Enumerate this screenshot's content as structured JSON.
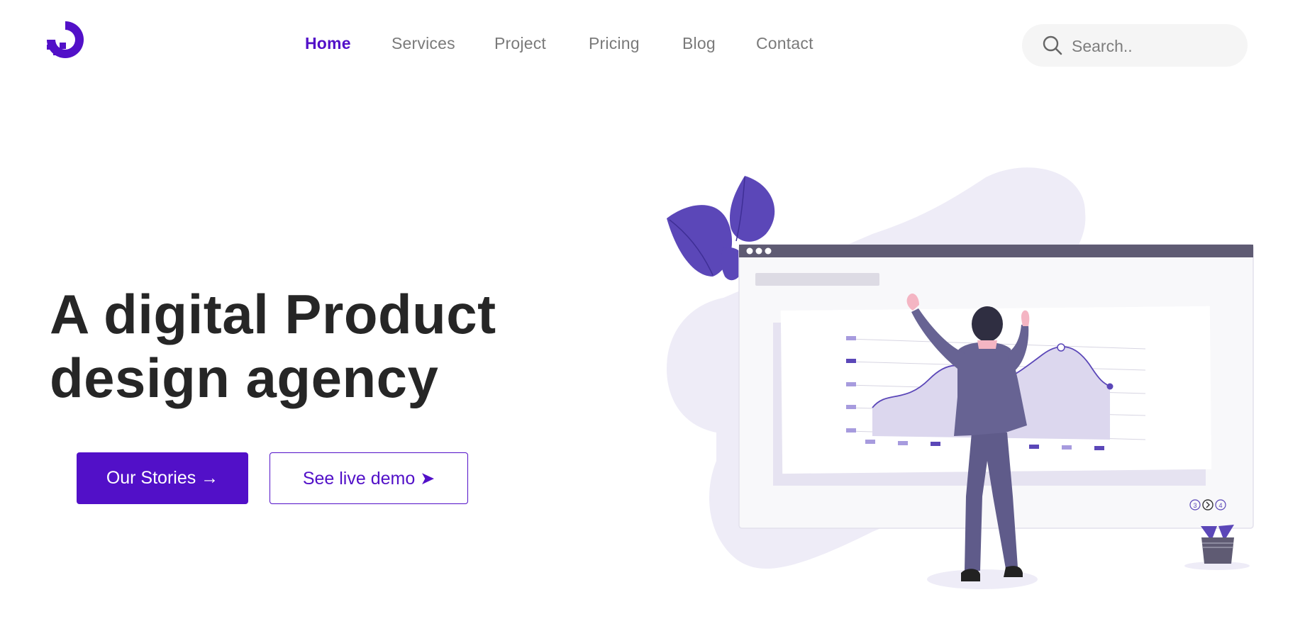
{
  "nav": {
    "items": [
      {
        "label": "Home",
        "active": true
      },
      {
        "label": "Services",
        "active": false
      },
      {
        "label": "Project",
        "active": false
      },
      {
        "label": "Pricing",
        "active": false
      },
      {
        "label": "Blog",
        "active": false
      },
      {
        "label": "Contact",
        "active": false
      }
    ]
  },
  "search": {
    "placeholder": "Search.."
  },
  "hero": {
    "headline_line1": "A digital Product",
    "headline_line2": "design agency",
    "primary_button": "Our Stories →",
    "secondary_button": "See live demo ➤"
  },
  "illustration": {
    "pager": {
      "prev": "3",
      "next": "4"
    }
  },
  "colors": {
    "brand": "#5210c8",
    "illustration_purple": "#5b47b8",
    "illustration_blob": "#eeecf7",
    "window_bar": "#5f5b73",
    "headline_text": "#262626",
    "nav_text": "#7a7a7a"
  }
}
